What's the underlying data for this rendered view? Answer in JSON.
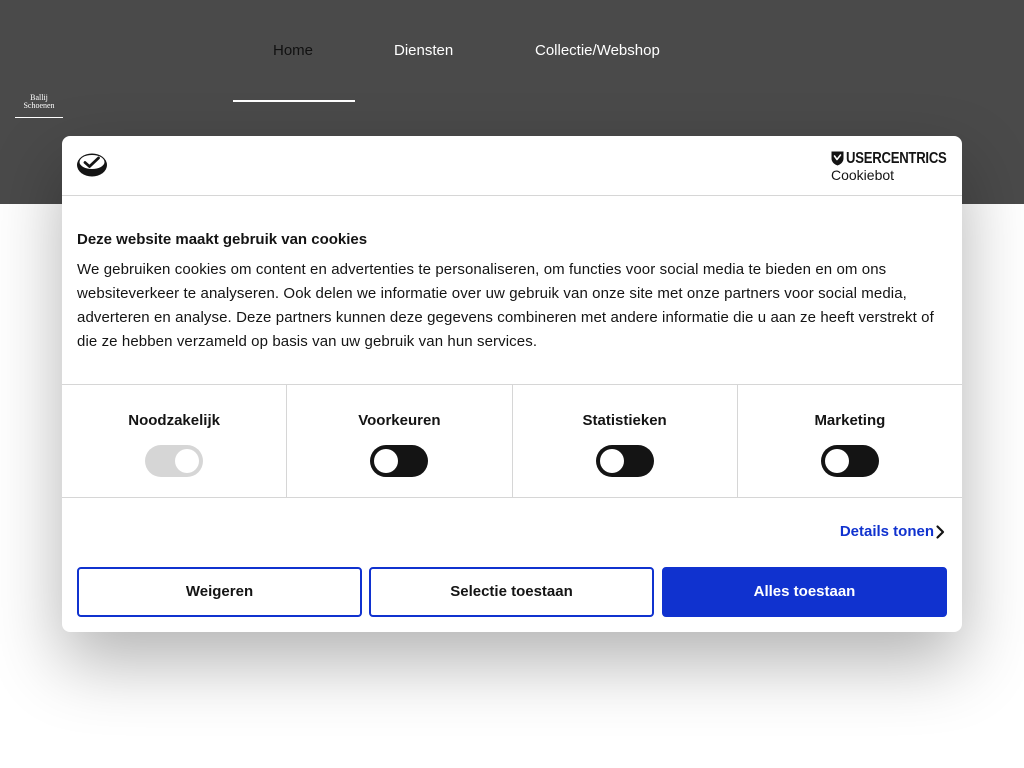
{
  "site": {
    "logo_lines": [
      "Ballij",
      "Schoenen"
    ],
    "nav": [
      {
        "label": "Home",
        "active": true
      },
      {
        "label": "Diensten",
        "active": false
      },
      {
        "label": "Collectie/Webshop",
        "active": false
      }
    ]
  },
  "dialog": {
    "logo_icon": "cookie-icon",
    "brand": {
      "name": "USERCENTRICS",
      "product": "Cookiebot",
      "icon": "shield-icon"
    },
    "title": "Deze website maakt gebruik van cookies",
    "body": "We gebruiken cookies om content en advertenties te personaliseren, om functies voor social media te bieden en om ons websiteverkeer te analyseren. Ook delen we informatie over uw gebruik van onze site met onze partners voor social media, adverteren en analyse. Deze partners kunnen deze gegevens combineren met andere informatie die u aan ze heeft verstrekt of die ze hebben verzameld op basis van uw gebruik van hun services.",
    "categories": [
      {
        "label": "Noodzakelijk",
        "checked": true,
        "disabled": true
      },
      {
        "label": "Voorkeuren",
        "checked": false,
        "disabled": false
      },
      {
        "label": "Statistieken",
        "checked": false,
        "disabled": false
      },
      {
        "label": "Marketing",
        "checked": false,
        "disabled": false
      }
    ],
    "details_label": "Details tonen",
    "details_icon": "chevron-right-icon",
    "buttons": {
      "decline": "Weigeren",
      "selection": "Selectie toestaan",
      "accept_all": "Alles toestaan"
    }
  },
  "colors": {
    "header_bg": "#4a4a4a",
    "accent": "#1032cf",
    "toggle_off": "#141414",
    "toggle_disabled": "#d6d6d6"
  }
}
